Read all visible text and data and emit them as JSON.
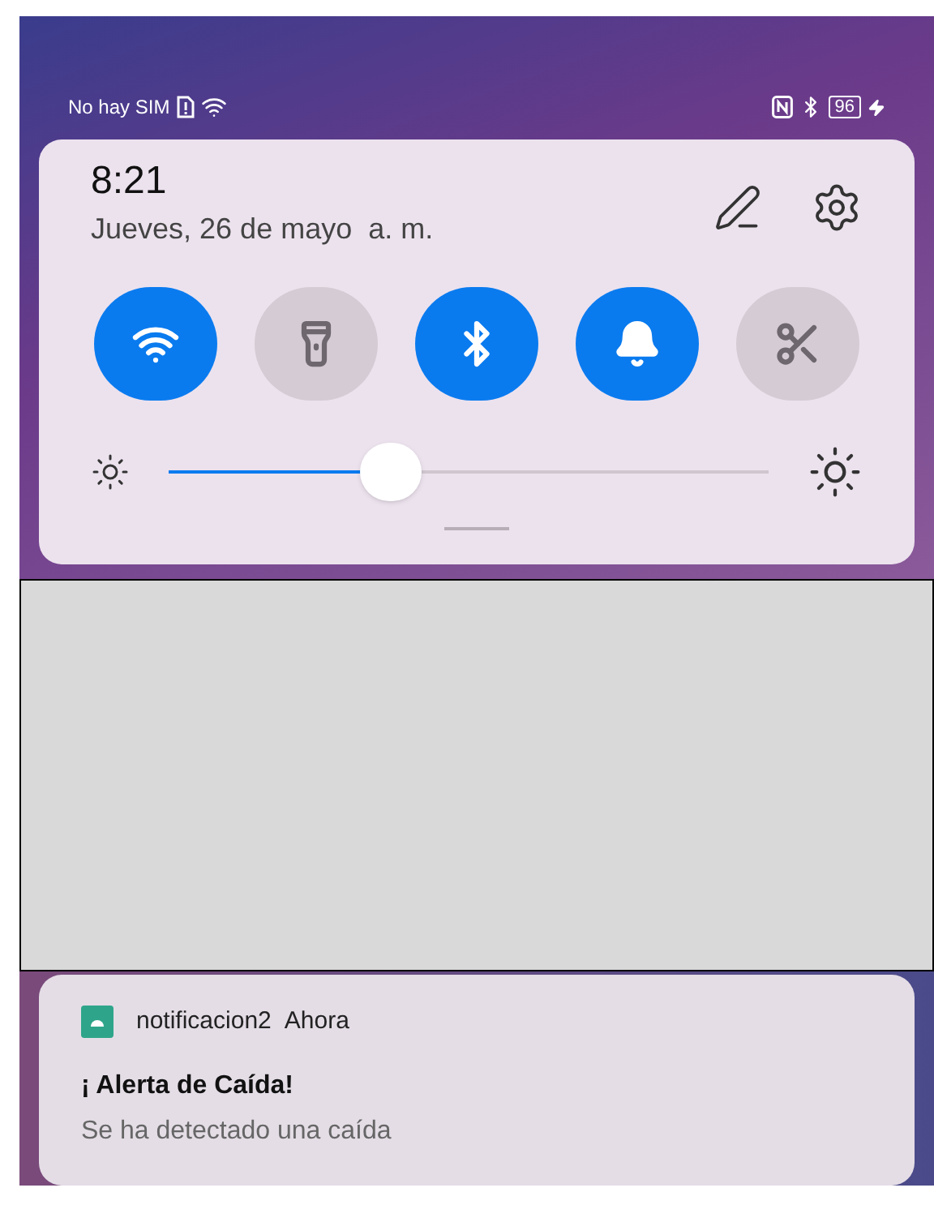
{
  "status_bar": {
    "carrier": "No hay SIM",
    "battery": "96"
  },
  "panel": {
    "time": "8:21",
    "date": "Jueves, 26 de mayo  a. m.",
    "toggles": [
      {
        "kind": "wifi",
        "on": true
      },
      {
        "kind": "flashlight",
        "on": false
      },
      {
        "kind": "bluetooth",
        "on": true
      },
      {
        "kind": "sound",
        "on": true
      },
      {
        "kind": "screenshot",
        "on": false
      }
    ],
    "brightness": {
      "level": 0.37
    }
  },
  "notification": {
    "app": "notificacion2",
    "time": "Ahora",
    "title": "¡ Alerta de Caída!",
    "body": "Se ha detectado una caída"
  }
}
